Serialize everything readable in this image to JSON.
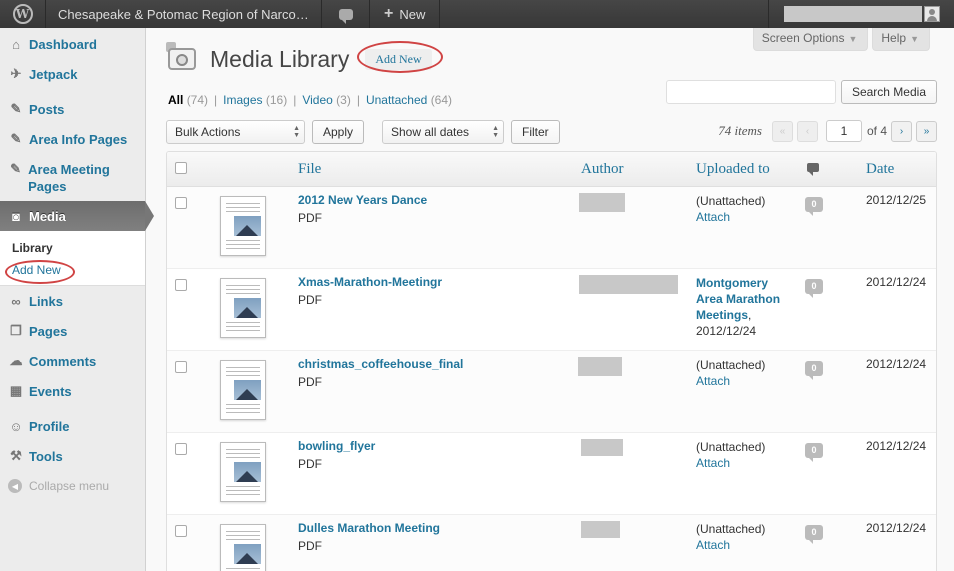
{
  "admin_bar": {
    "site_name": "Chesapeake & Potomac Region of Narco…",
    "new_label": "New"
  },
  "sidebar": {
    "items": [
      {
        "label": "Dashboard"
      },
      {
        "label": "Jetpack"
      },
      {
        "label": "Posts"
      },
      {
        "label": "Area Info Pages"
      },
      {
        "label": "Area Meeting Pages"
      },
      {
        "label": "Media"
      },
      {
        "label": "Links"
      },
      {
        "label": "Pages"
      },
      {
        "label": "Comments"
      },
      {
        "label": "Events"
      },
      {
        "label": "Profile"
      },
      {
        "label": "Tools"
      },
      {
        "label": "Collapse menu"
      }
    ],
    "submenu": [
      {
        "label": "Library"
      },
      {
        "label": "Add New"
      }
    ]
  },
  "screen_meta": {
    "screen_options": "Screen Options",
    "help": "Help"
  },
  "header": {
    "title": "Media Library",
    "add_new": "Add New"
  },
  "filters": [
    {
      "label": "All",
      "count": "(74)"
    },
    {
      "label": "Images",
      "count": "(16)"
    },
    {
      "label": "Video",
      "count": "(3)"
    },
    {
      "label": "Unattached",
      "count": "(64)"
    }
  ],
  "search": {
    "placeholder": "",
    "button": "Search Media"
  },
  "tablenav": {
    "bulk_actions": "Bulk Actions",
    "apply": "Apply",
    "dates": "Show all dates",
    "filter": "Filter",
    "items_count": "74 items",
    "first": "«",
    "prev": "‹",
    "current_page": "1",
    "of_pages": "of 4",
    "next": "›",
    "last": "»"
  },
  "table": {
    "columns": {
      "file": "File",
      "author": "Author",
      "uploaded_to": "Uploaded to",
      "date": "Date"
    },
    "rows": [
      {
        "title": "2012 New Years Dance",
        "type": "PDF",
        "uploaded": "(Unattached)",
        "action": "Attach",
        "comments": "0",
        "date": "2012/12/25"
      },
      {
        "title": "Xmas-Marathon-Meetingr",
        "type": "PDF",
        "uploaded_link": "Montgomery Area Marathon Meetings",
        "uploaded_date": "2012/12/24",
        "comments": "0",
        "date": "2012/12/24"
      },
      {
        "title": "christmas_coffeehouse_final",
        "type": "PDF",
        "uploaded": "(Unattached)",
        "action": "Attach",
        "comments": "0",
        "date": "2012/12/24"
      },
      {
        "title": "bowling_flyer",
        "type": "PDF",
        "uploaded": "(Unattached)",
        "action": "Attach",
        "comments": "0",
        "date": "2012/12/24"
      },
      {
        "title": "Dulles Marathon Meeting",
        "type": "PDF",
        "uploaded": "(Unattached)",
        "action": "Attach",
        "comments": "0",
        "date": "2012/12/24"
      }
    ]
  },
  "colors": {
    "link": "#21759b",
    "admin_bar": "#464646",
    "highlight_circle": "#d04444"
  }
}
